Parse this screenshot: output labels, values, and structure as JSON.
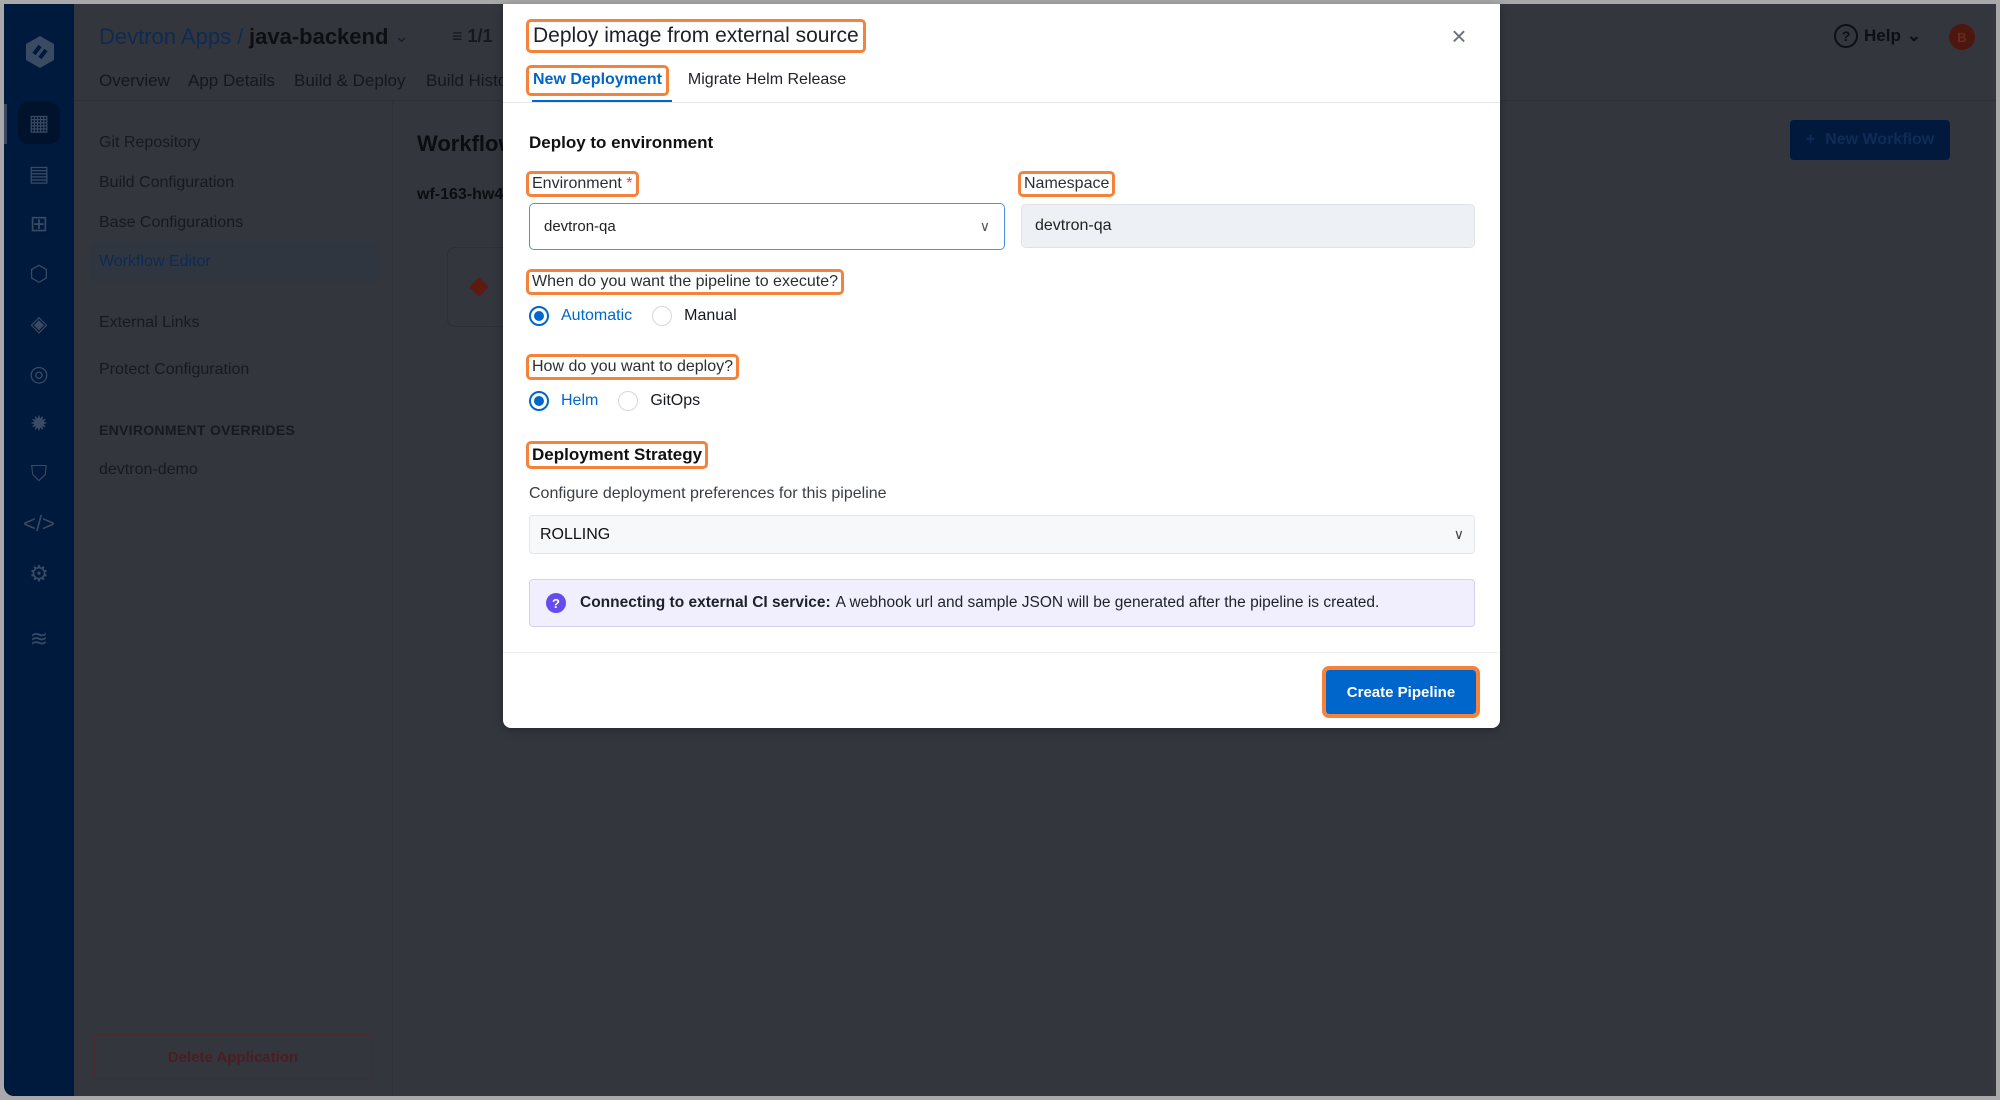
{
  "background": {
    "breadcrumb": {
      "parent": "Devtron Apps /",
      "app_name": "java-backend",
      "filter_count": "1/1"
    },
    "tabs": [
      "Overview",
      "App Details",
      "Build & Deploy",
      "Build History"
    ],
    "sidebar_items": [
      "Git Repository",
      "Build Configuration",
      "Base Configurations",
      "Workflow Editor",
      "External Links",
      "Protect Configuration"
    ],
    "active_sidebar_item": "Workflow Editor",
    "env_overrides_heading": "ENVIRONMENT OVERRIDES",
    "env_overrides": [
      "devtron-demo"
    ],
    "delete_label": "Delete Application",
    "workflow_title": "Workflow Editor",
    "workflow_name": "wf-163-hw4",
    "help_label": "Help",
    "avatar_initial": "B",
    "new_workflow_label": "New Workflow"
  },
  "modal": {
    "title": "Deploy image from external source",
    "close_icon": "close-icon",
    "tabs": [
      {
        "label": "New Deployment",
        "active": true
      },
      {
        "label": "Migrate Helm Release",
        "active": false
      }
    ],
    "section_title": "Deploy to environment",
    "environment": {
      "label": "Environment",
      "required_mark": "*",
      "value": "devtron-qa"
    },
    "namespace": {
      "label": "Namespace",
      "value": "devtron-qa"
    },
    "trigger": {
      "question": "When do you want the pipeline to execute?",
      "options": [
        "Automatic",
        "Manual"
      ],
      "selected": "Automatic"
    },
    "deploy_method": {
      "question": "How do you want to deploy?",
      "options": [
        "Helm",
        "GitOps"
      ],
      "selected": "Helm"
    },
    "strategy": {
      "title": "Deployment Strategy",
      "subtitle": "Configure deployment preferences for this pipeline",
      "value": "ROLLING"
    },
    "info": {
      "icon": "question-icon",
      "bold": "Connecting to external CI service:",
      "text": "A webhook url and sample JSON will be generated after the pipeline is created."
    },
    "create_button": "Create Pipeline"
  },
  "colors": {
    "primary": "#0066cc",
    "highlight": "#f5823b",
    "info_bg": "#f1effd",
    "required": "#f0423a"
  }
}
